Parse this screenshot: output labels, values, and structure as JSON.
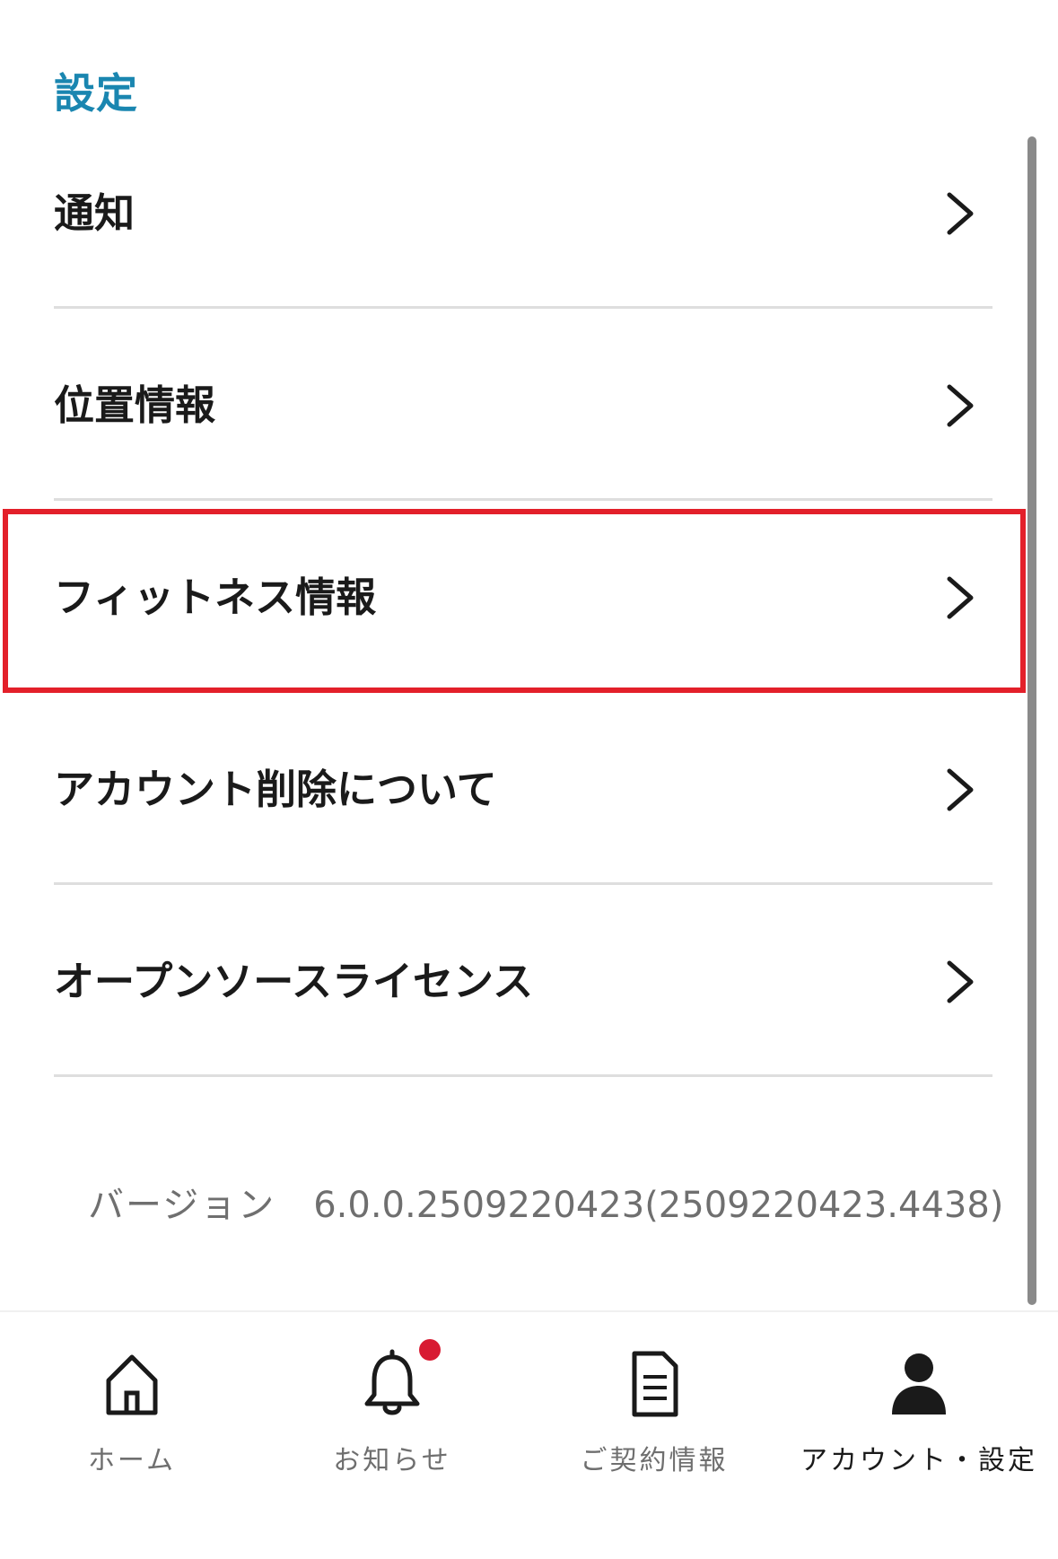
{
  "section_title": "設定",
  "menu": [
    {
      "label": "通知",
      "icon": "chevron-right-icon"
    },
    {
      "label": "位置情報",
      "icon": "chevron-right-icon"
    },
    {
      "label": "フィットネス情報",
      "icon": "chevron-right-icon",
      "highlighted": true
    },
    {
      "label": "アカウント削除について",
      "icon": "chevron-right-icon"
    },
    {
      "label": "オープンソースライセンス",
      "icon": "chevron-right-icon"
    }
  ],
  "version": {
    "label": "バージョン",
    "value": "6.0.0.2509220423(2509220423.4438)"
  },
  "tabbar": {
    "items": [
      {
        "label": "ホーム",
        "icon": "home-icon"
      },
      {
        "label": "お知らせ",
        "icon": "bell-icon",
        "has_badge": true
      },
      {
        "label": "ご契約情報",
        "icon": "document-icon"
      },
      {
        "label": "アカウント・設定",
        "icon": "person-icon",
        "active": true
      }
    ]
  },
  "colors": {
    "accent": "#1a86b0",
    "highlight_border": "#e3202a",
    "badge": "#d81b32",
    "divider": "#dedede"
  }
}
